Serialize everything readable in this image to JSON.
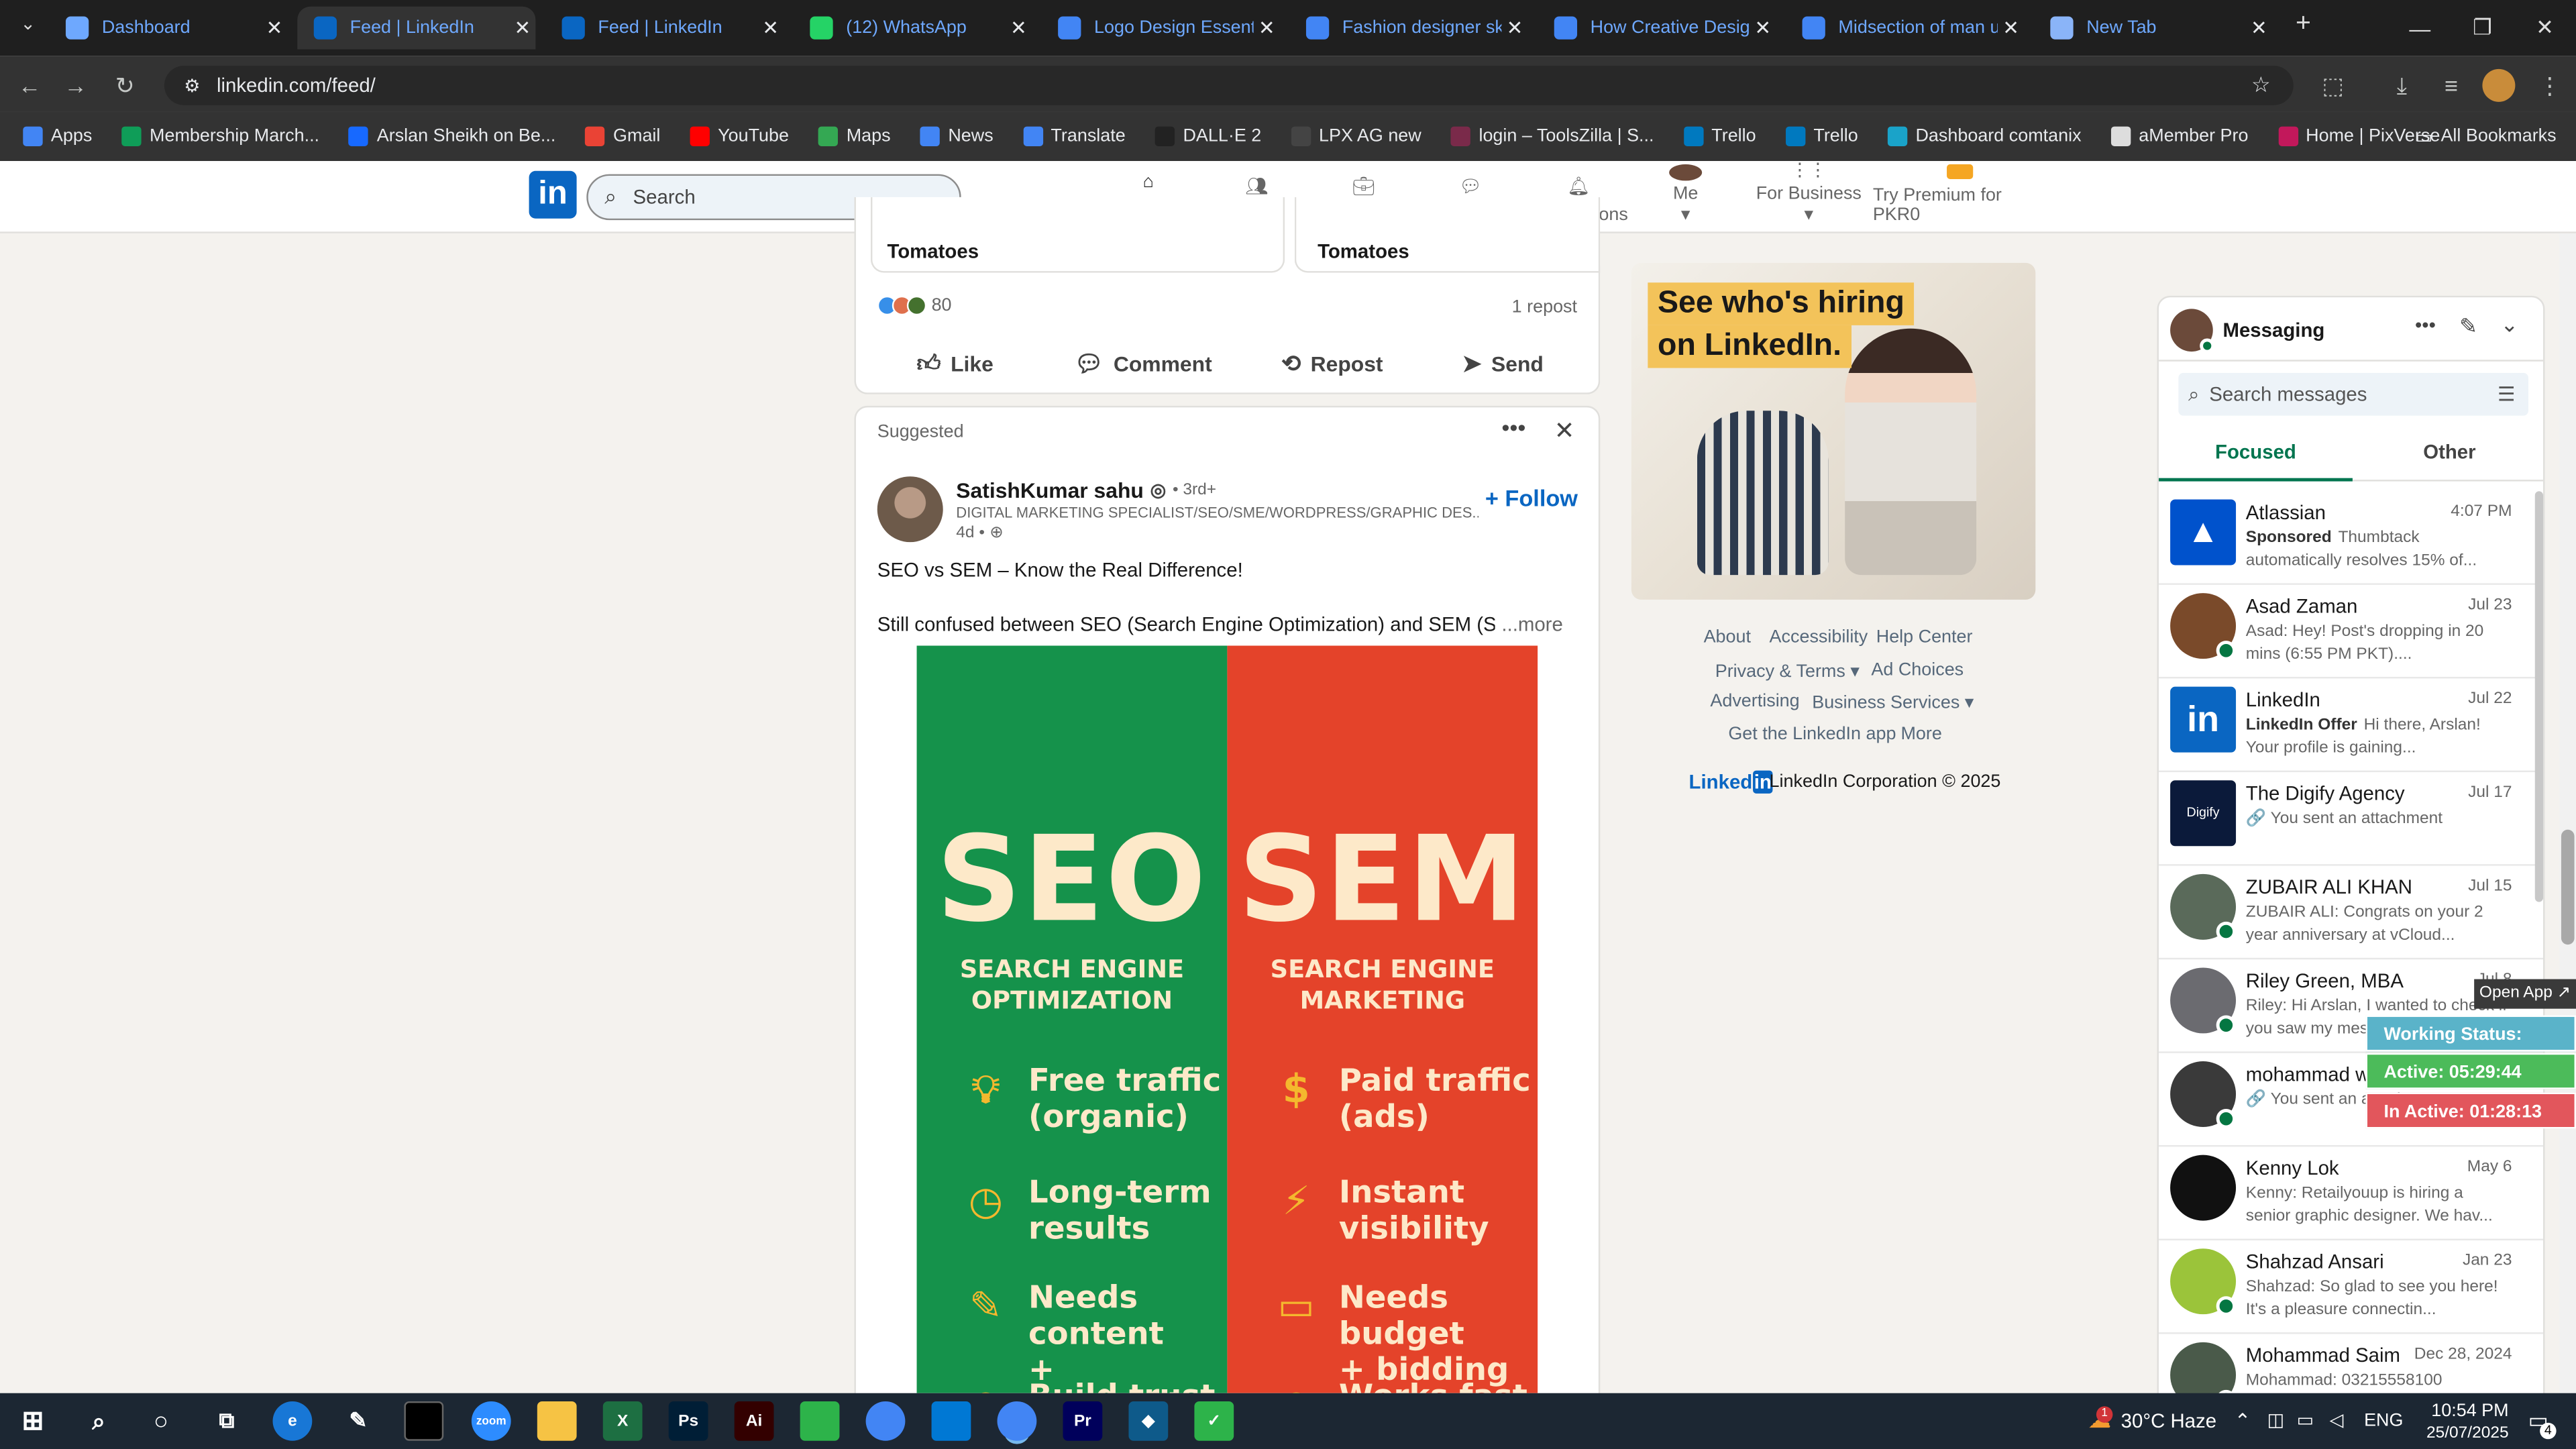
{
  "browser": {
    "tabs": [
      {
        "title": "Dashboard",
        "icon": "dashboard-icon",
        "color": "#6ea8fe"
      },
      {
        "title": "Feed | LinkedIn",
        "icon": "linkedin-icon",
        "color": "#0a66c2"
      },
      {
        "title": "Feed | LinkedIn",
        "icon": "linkedin-icon",
        "color": "#0a66c2"
      },
      {
        "title": "(12) WhatsApp",
        "icon": "whatsapp-icon",
        "color": "#25d366"
      },
      {
        "title": "Logo Design Essenti",
        "icon": "doc-icon",
        "color": "#4285f4"
      },
      {
        "title": "Fashion designer ske",
        "icon": "doc-icon",
        "color": "#4285f4"
      },
      {
        "title": "How Creative Design",
        "icon": "doc-icon",
        "color": "#4285f4"
      },
      {
        "title": "Midsection of man u",
        "icon": "doc-icon",
        "color": "#4285f4"
      },
      {
        "title": "New Tab",
        "icon": "chrome-icon",
        "color": "#8ab4f8"
      }
    ],
    "url": "linkedin.com/feed/",
    "bookmarks": [
      {
        "label": "Apps",
        "color": "#4285f4"
      },
      {
        "label": "Membership March...",
        "color": "#0f9d58"
      },
      {
        "label": "Arslan Sheikh on Be...",
        "color": "#1769ff"
      },
      {
        "label": "Gmail",
        "color": "#ea4335"
      },
      {
        "label": "YouTube",
        "color": "#ff0000"
      },
      {
        "label": "Maps",
        "color": "#34a853"
      },
      {
        "label": "News",
        "color": "#4285f4"
      },
      {
        "label": "Translate",
        "color": "#4285f4"
      },
      {
        "label": "DALL·E 2",
        "color": "#222222"
      },
      {
        "label": "LPX AG new",
        "color": "#444444"
      },
      {
        "label": "login – ToolsZilla | S...",
        "color": "#7a2a4a"
      },
      {
        "label": "Trello",
        "color": "#0079bf"
      },
      {
        "label": "Trello",
        "color": "#0079bf"
      },
      {
        "label": "Dashboard comtanix",
        "color": "#1aa3c9"
      },
      {
        "label": "aMember Pro",
        "color": "#dddddd"
      },
      {
        "label": "Home | PixVerse",
        "color": "#c2185b"
      }
    ],
    "all_bookmarks": "All Bookmarks"
  },
  "linkedin": {
    "logo": "in",
    "search_placeholder": "Search",
    "nav": [
      {
        "label": "Home",
        "icon": "home-icon",
        "selected": true
      },
      {
        "label": "My Network",
        "icon": "network-icon"
      },
      {
        "label": "Jobs",
        "icon": "briefcase-icon"
      },
      {
        "label": "Messaging",
        "icon": "messaging-icon"
      },
      {
        "label": "Notifications",
        "icon": "bell-icon"
      },
      {
        "label": "Me",
        "icon": "avatar-icon"
      },
      {
        "label": "For Business",
        "icon": "grid-icon"
      },
      {
        "label": "Try Premium for PKR0",
        "icon": "premium-icon"
      }
    ]
  },
  "feed": {
    "prev_post": {
      "cell_left": "Tomatoes",
      "cell_right": "Tomatoes",
      "reactions": "80",
      "reposts": "1 repost"
    },
    "actions": [
      "Like",
      "Comment",
      "Repost",
      "Send"
    ],
    "suggested_label": "Suggested",
    "post": {
      "author": "SatishKumar sahu",
      "degree": "• 3rd+",
      "headline": "DIGITAL MARKETING SPECIALIST/SEO/SME/WORDPRESS/GRAPHIC DES...",
      "age": "4d •",
      "follow": "+ Follow",
      "line1": "SEO vs SEM – Know the Real Difference!",
      "line2": "Still confused between SEO (Search Engine Optimization) and SEM (Search",
      "more": "...more",
      "image": {
        "left_title": "SEO",
        "left_sub1": "SEARCH ENGINE",
        "left_sub2": "OPTIMIZATION",
        "right_title": "SEM",
        "right_sub1": "SEARCH ENGINE",
        "right_sub2": "MARKETING",
        "left_features": [
          [
            "Free traffic",
            "(organic)"
          ],
          [
            "Long-term",
            "results"
          ],
          [
            "Needs content",
            "+ keywords"
          ],
          [
            "Build trust",
            ""
          ]
        ],
        "right_features": [
          [
            "Paid traffic",
            "(ads)"
          ],
          [
            "Instant",
            "visibility"
          ],
          [
            "Needs budget",
            "+ bidding"
          ],
          [
            "Works fast",
            ""
          ]
        ],
        "left_color": "#15924b",
        "right_color": "#e4432a"
      }
    }
  },
  "rail": {
    "ad_line1": "See who's hiring",
    "ad_line2": "on LinkedIn.",
    "footer": {
      "about": "About",
      "accessibility": "Accessibility",
      "help": "Help Center",
      "privacy": "Privacy & Terms",
      "adchoices": "Ad Choices",
      "advertising": "Advertising",
      "business": "Business Services",
      "app": "Get the LinkedIn app",
      "more": "More",
      "corp": "LinkedIn Corporation © 2025"
    }
  },
  "messaging": {
    "title": "Messaging",
    "search_placeholder": "Search messages",
    "tab_focused": "Focused",
    "tab_other": "Other",
    "conversations": [
      {
        "name": "Atlassian",
        "date": "4:07 PM",
        "preview_bold": "Sponsored",
        "preview": "Thumbtack automatically resolves 15% of...",
        "avatar": "#0052cc",
        "online": false
      },
      {
        "name": "Asad Zaman",
        "date": "Jul 23",
        "preview_bold": "",
        "preview": "Asad: Hey! Post's dropping in 20 mins (6:55 PM PKT)....",
        "avatar": "#7a4a2a",
        "online": true
      },
      {
        "name": "LinkedIn",
        "date": "Jul 22",
        "preview_bold": "LinkedIn Offer",
        "preview": "Hi there, Arslan! Your profile is gaining...",
        "avatar": "#0a66c2",
        "online": false
      },
      {
        "name": "The Digify Agency",
        "date": "Jul 17",
        "preview_bold": "",
        "preview": "🔗 You sent an attachment",
        "avatar": "#0b1a3a",
        "online": false
      },
      {
        "name": "ZUBAIR ALI KHAN",
        "date": "Jul 15",
        "preview_bold": "",
        "preview": "ZUBAIR ALI: Congrats on your 2 year anniversary at vCloud...",
        "avatar": "#5a6a5a",
        "online": true
      },
      {
        "name": "Riley Green, MBA",
        "date": "Jul 8",
        "preview_bold": "",
        "preview": "Riley: Hi Arslan, I wanted to check if you saw my message...",
        "avatar": "#6b6b70",
        "online": true
      },
      {
        "name": "mohammad wasim",
        "date": "Jul 8",
        "preview_bold": "",
        "preview": "🔗 You sent an attachment",
        "avatar": "#3a3a3a",
        "online": true
      },
      {
        "name": "Kenny Lok",
        "date": "May 6",
        "preview_bold": "",
        "preview": "Kenny: Retailyouup is hiring a senior graphic designer. We hav...",
        "avatar": "#111111",
        "online": false
      },
      {
        "name": "Shahzad Ansari",
        "date": "Jan 23",
        "preview_bold": "",
        "preview": "Shahzad: So glad to see you here! It's a pleasure connectin...",
        "avatar": "#9bc43a",
        "online": true
      },
      {
        "name": "Mohammad Saim",
        "date": "Dec 28, 2024",
        "preview_bold": "",
        "preview": "Mohammad: 03215558100",
        "avatar": "#4a5a4a",
        "online": true
      }
    ]
  },
  "overlay": {
    "open_app": "Open App ↗",
    "working": "Working Status: Active",
    "active": "Active: 05:29:44",
    "inactive": "In Active: 01:28:13"
  },
  "taskbar": {
    "notification_count": "1",
    "weather": "30°C  Haze",
    "lang": "ENG",
    "time": "10:54 PM",
    "date": "25/07/2025",
    "notif_badge": "4",
    "apps": [
      {
        "name": "file-explorer",
        "label": "",
        "color": "#f6c344"
      },
      {
        "name": "excel",
        "label": "X",
        "color": "#1d6f42"
      },
      {
        "name": "photoshop",
        "label": "Ps",
        "color": "#001e36"
      },
      {
        "name": "illustrator",
        "label": "Ai",
        "color": "#330000"
      },
      {
        "name": "chrome",
        "label": "",
        "color": "#4285f4"
      },
      {
        "name": "vscode",
        "label": "",
        "color": "#0078d4"
      },
      {
        "name": "premiere",
        "label": "Pr",
        "color": "#00005b"
      }
    ]
  }
}
